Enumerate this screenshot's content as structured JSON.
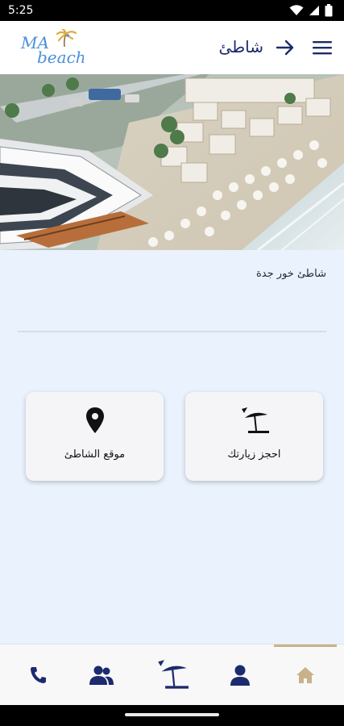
{
  "status_bar": {
    "time": "5:25",
    "icons": [
      "wifi-icon",
      "signal-icon",
      "battery-icon"
    ]
  },
  "header": {
    "logo_text_top": "MA",
    "logo_text_bottom": "beach",
    "title": "شاطئ",
    "back_icon": "arrow-right-icon",
    "menu_icon": "hamburger-menu-icon"
  },
  "hero": {
    "description_icon": "beach-resort-photo"
  },
  "content": {
    "beach_name": "شاطئ خور جدة",
    "cards": {
      "book": {
        "label": "احجز زيارتك",
        "icon": "beach-umbrella-icon"
      },
      "location": {
        "label": "موقع الشاطئ",
        "icon": "map-pin-icon"
      }
    }
  },
  "bottom_nav": {
    "items": [
      {
        "icon": "phone-icon"
      },
      {
        "icon": "users-icon"
      },
      {
        "icon": "beach-umbrella-icon"
      },
      {
        "icon": "profile-icon"
      },
      {
        "icon": "home-icon"
      }
    ],
    "active_index": 4
  },
  "colors": {
    "primary": "#1c2a6e",
    "background": "#eaf2fd",
    "accent": "#c9b28a",
    "logo_blue": "#4a90d9",
    "logo_gold": "#e0a93b"
  }
}
